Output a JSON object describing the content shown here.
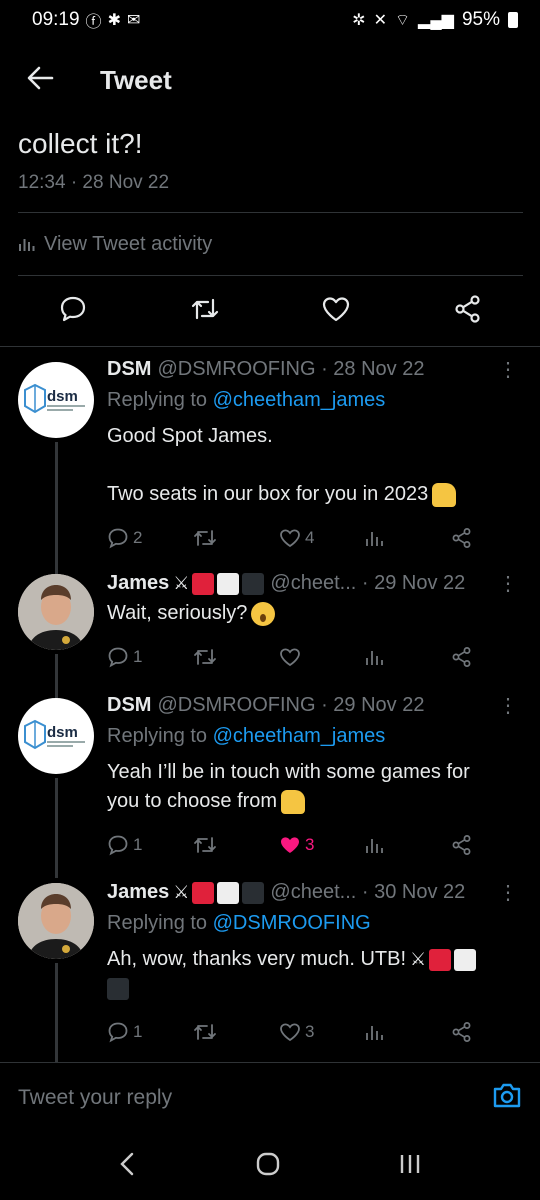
{
  "status_bar": {
    "time": "09:19",
    "battery": "95%"
  },
  "header": {
    "title": "Tweet"
  },
  "main_tweet": {
    "text_tail": "collect it?!",
    "timestamp": "12:34 · 28 Nov 22",
    "activity_label": "View Tweet activity"
  },
  "replies": [
    {
      "name": "DSM",
      "handle": "@DSMROOFING · 28 Nov 22",
      "replying_prefix": "Replying to ",
      "replying_to": "@cheetham_james",
      "text_line1": "Good Spot James.",
      "text_line2": "Two seats in our box for you in 2023",
      "reply_count": "2",
      "retweet_count": "",
      "like_count": "4"
    },
    {
      "name": "James",
      "handle": "@cheet... · 29 Nov 22",
      "text_line1": "Wait, seriously?",
      "reply_count": "1",
      "retweet_count": "",
      "like_count": ""
    },
    {
      "name": "DSM",
      "handle": "@DSMROOFING · 29 Nov 22",
      "replying_prefix": "Replying to ",
      "replying_to": "@cheetham_james",
      "text_line1": "Yeah I’ll be in touch with some games for",
      "text_line2": "you to choose from",
      "reply_count": "1",
      "retweet_count": "",
      "like_count": "3"
    },
    {
      "name": "James",
      "handle": "@cheet... · 30 Nov 22",
      "replying_prefix": "Replying to ",
      "replying_to": "@DSMROOFING",
      "text_line1": "Ah, wow, thanks very much. UTB!",
      "reply_count": "1",
      "retweet_count": "",
      "like_count": "3"
    }
  ],
  "dsm_logo_text": "dsm",
  "reply_composer": {
    "placeholder": "Tweet your reply"
  },
  "colors": {
    "background": "#000000",
    "text": "#e7e9ea",
    "muted": "#71767b",
    "link": "#1d9bf0",
    "like": "#f91880",
    "divider": "#2f3336"
  },
  "icons": [
    "back-arrow-icon",
    "reply-icon",
    "retweet-icon",
    "like-icon",
    "share-icon",
    "analytics-icon",
    "more-icon",
    "camera-icon"
  ]
}
